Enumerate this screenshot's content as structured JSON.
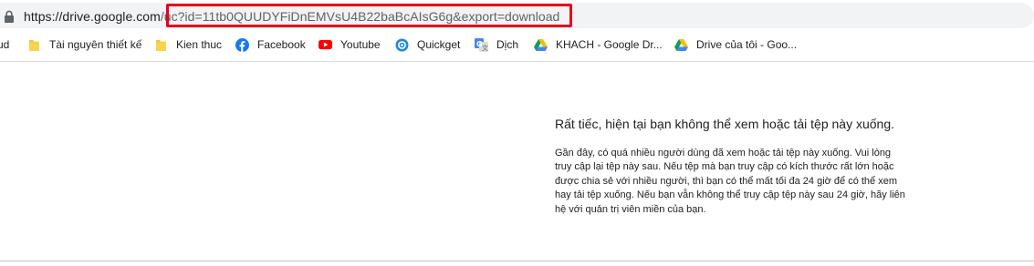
{
  "address_bar": {
    "url_host": "https://drive.google.com",
    "url_path": "/uc?id=11tb0QUUDYFiDnEMVsU4B22baBcAIsG6g&export=download",
    "highlight_color": "#e8001c"
  },
  "bookmarks": [
    {
      "label": "ud",
      "icon": "folder-icon"
    },
    {
      "label": "Tài nguyên thiết kế",
      "icon": "folder-icon"
    },
    {
      "label": "Kien thuc",
      "icon": "folder-icon"
    },
    {
      "label": "Facebook",
      "icon": "facebook-icon"
    },
    {
      "label": "Youtube",
      "icon": "youtube-icon"
    },
    {
      "label": "Quickget",
      "icon": "quickget-icon"
    },
    {
      "label": "Dịch",
      "icon": "google-translate-icon"
    },
    {
      "label": "KHACH - Google Dr...",
      "icon": "google-drive-icon"
    },
    {
      "label": "Drive của tôi - Goo...",
      "icon": "google-drive-icon"
    }
  ],
  "error": {
    "title": "Rất tiếc, hiện tại bạn không thể xem hoặc tải tệp này xuống.",
    "body_lines": [
      "Gần đây, có quá nhiều người dùng đã xem hoặc tải tệp này xuống. Vui lòng",
      "truy cập lại tệp này sau. Nếu tệp mà bạn truy cập có kích thước rất lớn hoặc",
      "được chia sẻ với nhiều người, thì bạn có thể mất tối đa 24 giờ để có thể xem",
      "hay tải tệp xuống. Nếu bạn vẫn không thể truy cập tệp này sau 24 giờ, hãy liên",
      "hệ với quản trị viên miền của bạn."
    ]
  }
}
